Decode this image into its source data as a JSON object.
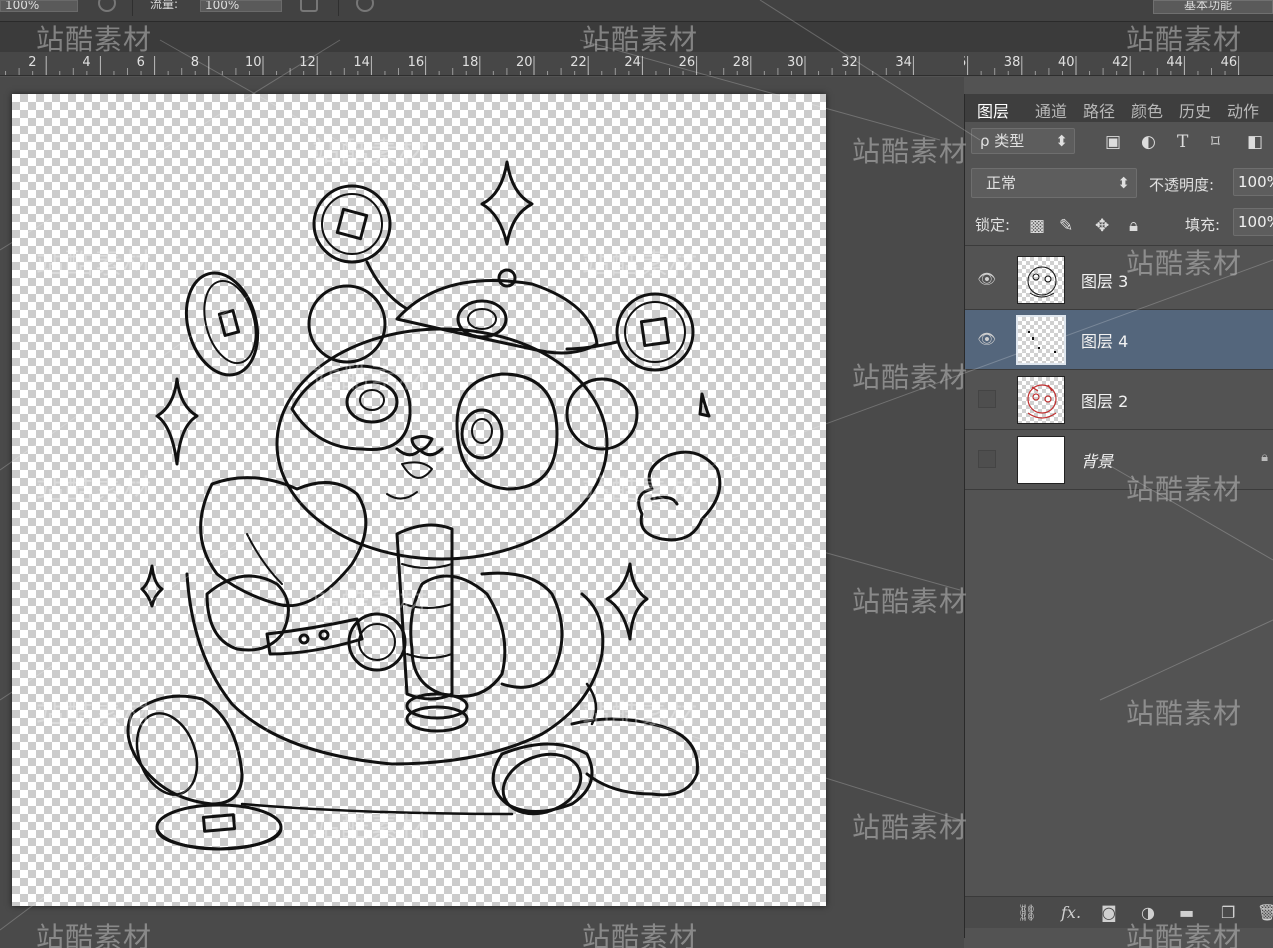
{
  "options_bar": {
    "field1_value": "100%",
    "field2_label": "流量:",
    "field2_value": "100%",
    "workspace": "基本功能"
  },
  "ruler": {
    "ticks": [
      "2",
      "4",
      "6",
      "8",
      "10",
      "12",
      "14",
      "16",
      "18",
      "20",
      "22",
      "24",
      "26",
      "28",
      "30",
      "32",
      "34",
      "36",
      "38",
      "40",
      "42",
      "44",
      "46"
    ]
  },
  "panel": {
    "tabs": [
      "图层",
      "通道",
      "路径",
      "颜色",
      "历史",
      "动作"
    ],
    "active_tab": "图层",
    "filter_label": "ρ 类型",
    "blend_mode": "正常",
    "opacity_label": "不透明度:",
    "opacity_value": "100%",
    "lock_label": "锁定:",
    "fill_label": "填充:",
    "fill_value": "100%",
    "layers": [
      {
        "name": "图层 3",
        "visible": true,
        "selected": false
      },
      {
        "name": "图层 4",
        "visible": true,
        "selected": true
      },
      {
        "name": "图层 2",
        "visible": false,
        "selected": false
      },
      {
        "name": "背景",
        "visible": false,
        "selected": false,
        "locked": true
      }
    ],
    "footer_fx": "fx."
  },
  "watermark": "站酷素材",
  "colors": {
    "selected_layer": "#54667c",
    "panel_bg": "#535353",
    "canvas_area": "#4a4a4a"
  }
}
